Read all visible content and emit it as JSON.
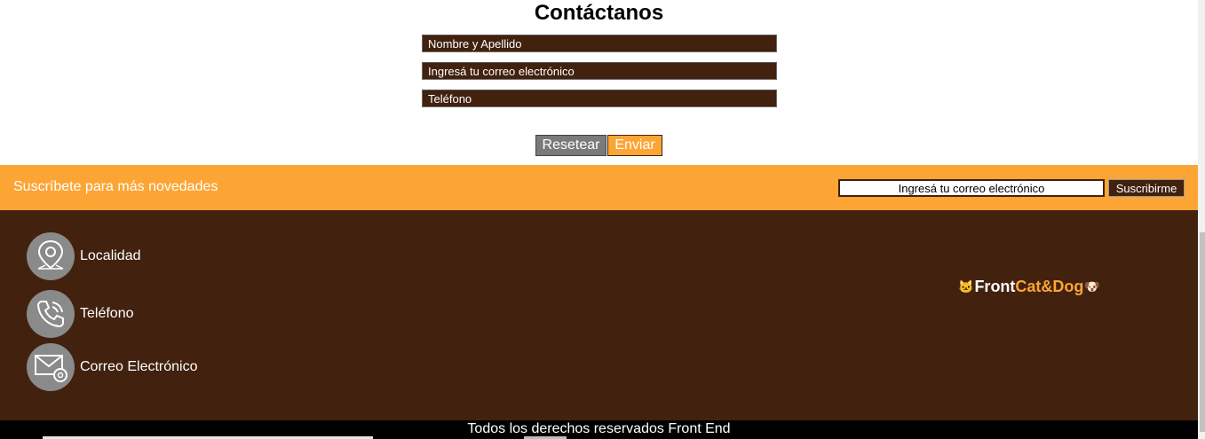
{
  "contact": {
    "title": "Contáctanos",
    "name_placeholder": "Nombre y Apellido",
    "email_placeholder": "Ingresá tu correo electrónico",
    "phone_placeholder": "Teléfono",
    "reset_label": "Resetear",
    "send_label": "Enviar"
  },
  "subscribe": {
    "text": "Suscríbete para más novedades",
    "email_placeholder": "Ingresá tu correo electrónico",
    "button_label": "Suscribirme"
  },
  "footer": {
    "items": [
      {
        "label": "Localidad",
        "icon": "location-pin-icon"
      },
      {
        "label": "Teléfono",
        "icon": "phone-icon"
      },
      {
        "label": "Correo Electrónico",
        "icon": "mail-icon"
      }
    ],
    "brand": {
      "part1": "Front",
      "part2": "Cat&Dog",
      "icon_left": "🐱",
      "icon_right": "🐶"
    },
    "copyright": "Todos los derechos reservados Front End"
  },
  "colors": {
    "brown": "#42210f",
    "orange": "#fca535",
    "gray": "#8a8a8a"
  }
}
